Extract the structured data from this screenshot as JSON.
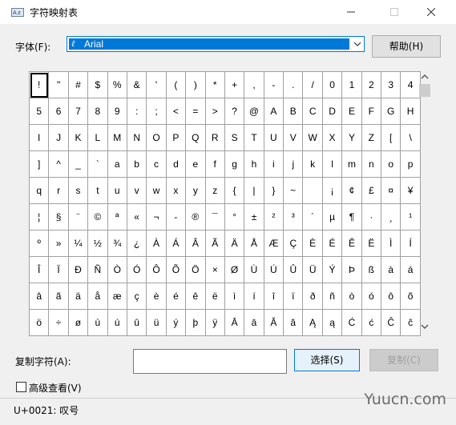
{
  "window": {
    "title": "字符映射表",
    "minimize": "—",
    "close": "✕"
  },
  "font": {
    "label": "字体(F):",
    "selected": "Arial",
    "icon": "ℓ"
  },
  "help_button": "帮助(H)",
  "grid": {
    "rows": [
      [
        "!",
        "\"",
        "#",
        "$",
        "%",
        "&",
        "'",
        "(",
        ")",
        "*",
        "+",
        ",",
        "-",
        ".",
        "/",
        "0",
        "1",
        "2",
        "3",
        "4"
      ],
      [
        "5",
        "6",
        "7",
        "8",
        "9",
        ":",
        ";",
        "<",
        "=",
        ">",
        "?",
        "@",
        "A",
        "B",
        "C",
        "D",
        "E",
        "F",
        "G",
        "H"
      ],
      [
        "I",
        "J",
        "K",
        "L",
        "M",
        "N",
        "O",
        "P",
        "Q",
        "R",
        "S",
        "T",
        "U",
        "V",
        "W",
        "X",
        "Y",
        "Z",
        "[",
        "\\"
      ],
      [
        "]",
        "^",
        "_",
        "`",
        "a",
        "b",
        "c",
        "d",
        "e",
        "f",
        "g",
        "h",
        "i",
        "j",
        "k",
        "l",
        "m",
        "n",
        "o",
        "p"
      ],
      [
        "q",
        "r",
        "s",
        "t",
        "u",
        "v",
        "w",
        "x",
        "y",
        "z",
        "{",
        "|",
        "}",
        "~",
        "",
        "¡",
        "¢",
        "£",
        "¤",
        "¥"
      ],
      [
        "¦",
        "§",
        "¨",
        "©",
        "ª",
        "«",
        "¬",
        "-",
        "®",
        "¯",
        "°",
        "±",
        "²",
        "³",
        "´",
        "µ",
        "¶",
        "·",
        "¸",
        "¹"
      ],
      [
        "º",
        "»",
        "¼",
        "½",
        "¾",
        "¿",
        "À",
        "Á",
        "Â",
        "Ã",
        "Ä",
        "Å",
        "Æ",
        "Ç",
        "È",
        "É",
        "Ê",
        "Ë",
        "Ì",
        "Í"
      ],
      [
        "Î",
        "Ï",
        "Ð",
        "Ñ",
        "Ò",
        "Ó",
        "Ô",
        "Õ",
        "Ö",
        "×",
        "Ø",
        "Ù",
        "Ú",
        "Û",
        "Ü",
        "Ý",
        "Þ",
        "ß",
        "à",
        "á"
      ],
      [
        "â",
        "ã",
        "ä",
        "å",
        "æ",
        "ç",
        "è",
        "é",
        "ê",
        "ë",
        "ì",
        "í",
        "î",
        "ï",
        "ð",
        "ñ",
        "ò",
        "ó",
        "ô",
        "õ"
      ],
      [
        "ö",
        "÷",
        "ø",
        "ù",
        "ú",
        "û",
        "ü",
        "ý",
        "þ",
        "ÿ",
        "Ā",
        "ā",
        "Ă",
        "ă",
        "Ą",
        "ą",
        "Ć",
        "ć",
        "Ĉ",
        "ĉ"
      ]
    ]
  },
  "copy": {
    "label": "复制字符(A):",
    "value": "",
    "select_button": "选择(S)",
    "copy_button": "复制(C)"
  },
  "advanced": {
    "label": "高级查看(V)"
  },
  "status": {
    "text": "U+0021: 叹号"
  },
  "watermark": "Yuucn.com",
  "colors": {
    "accent": "#0078d7"
  },
  "icons": {
    "app": "charmap-icon",
    "dropdown": "chevron-down-icon",
    "scroll_up": "scroll-up-icon",
    "scroll_down": "scroll-down-icon"
  }
}
